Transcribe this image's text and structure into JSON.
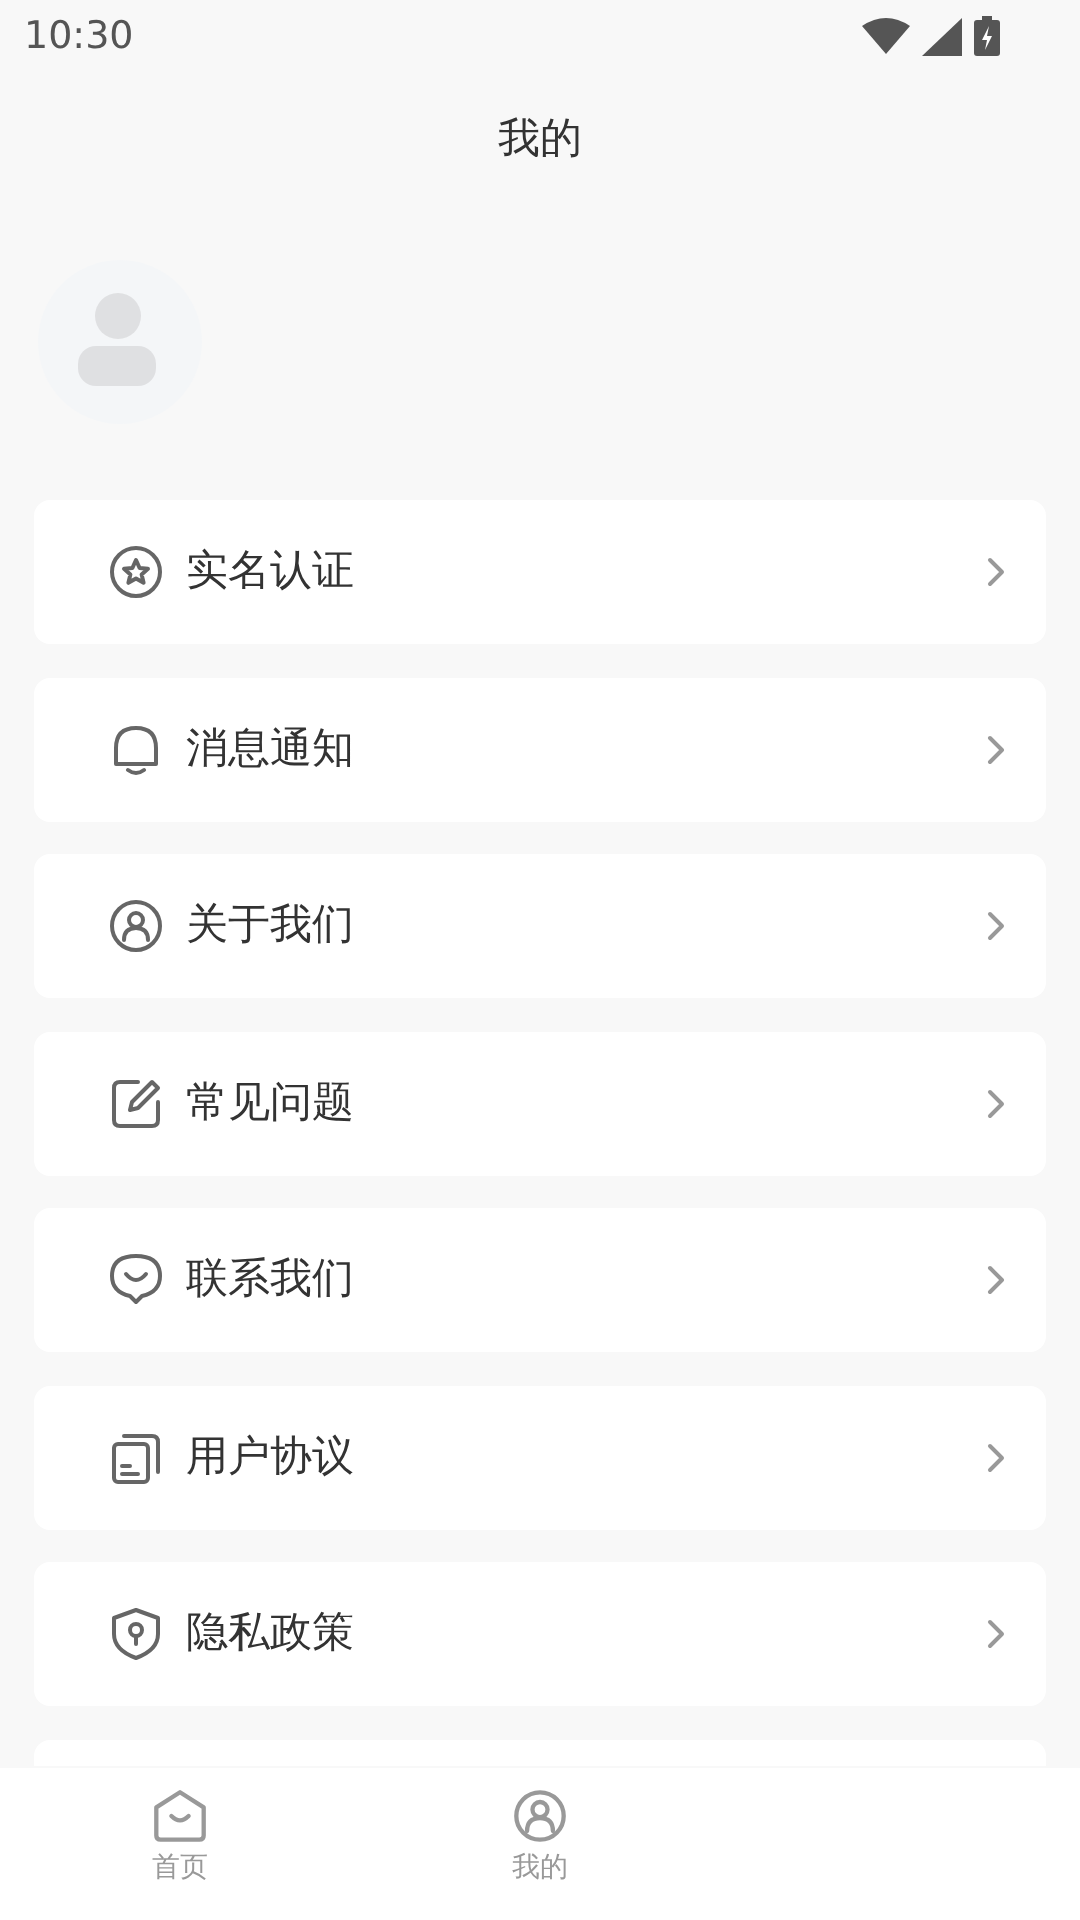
{
  "status_bar": {
    "time": "10:30"
  },
  "header": {
    "title": "我的"
  },
  "menu": [
    {
      "kind": "verify",
      "label": "实名认证"
    },
    {
      "kind": "notify",
      "label": "消息通知"
    },
    {
      "kind": "about",
      "label": "关于我们"
    },
    {
      "kind": "faq",
      "label": "常见问题"
    },
    {
      "kind": "contact",
      "label": "联系我们"
    },
    {
      "kind": "agreement",
      "label": "用户协议"
    },
    {
      "kind": "privacy",
      "label": "隐私政策"
    }
  ],
  "bottom_nav": [
    {
      "kind": "home",
      "label": "首页",
      "selected": false
    },
    {
      "kind": "mine",
      "label": "我的",
      "selected": false
    }
  ]
}
